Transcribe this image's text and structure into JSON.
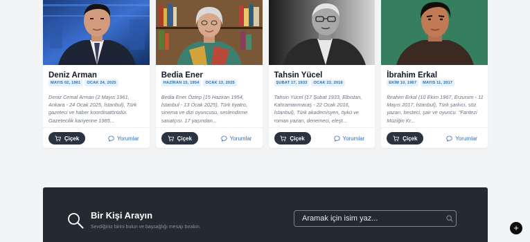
{
  "people": [
    {
      "name": "Deniz Arman",
      "birth": "MAYIS 02, 1961",
      "death": "OCAK 24, 2025",
      "excerpt": "Deniz Cemal Arman (2 Mayıs 1961, Ankara - 24 Ocak 2025, İstanbul), Türk gazeteci ve haber koordinatörüdür. Gazetecilik kariyerine 1985...",
      "flower_label": "Çiçek",
      "comments_label": "Yorumlar"
    },
    {
      "name": "Bedia Ener",
      "birth": "HAZİRAN 15, 1954",
      "death": "OCAK 13, 2025",
      "excerpt": "Bedia Ener Öztep (15 Haziran 1954, İstanbul - 13 Ocak 2025), Türk tiyatro, sinema ve dizi oyuncusu, seslendirme sanatçısı. 17 yaşından...",
      "flower_label": "Çiçek",
      "comments_label": "Yorumlar"
    },
    {
      "name": "Tahsin Yücel",
      "birth": "ŞUBAT 17, 1933",
      "death": "OCAK 22, 2016",
      "excerpt": "Tahsin Yücel (17 Şubat 1933, Elbistan, Kahramanmaraş - 22 Ocak 2016, İstanbul), Türk akademisyen, öykü ve roman yazarı, denemeci, eleşt...",
      "flower_label": "Çiçek",
      "comments_label": "Yorumlar"
    },
    {
      "name": "İbrahim Erkal",
      "birth": "EKİM 10, 1967",
      "death": "MAYIS 11, 2017",
      "excerpt": "İbrahim Erkal (10 Ekim 1967, Erzurum - 11 Mayıs 2017, İstanbul), Türk şarkıcı, söz yazarı, besteci, şair ve oyuncu. \"Fantezi Müziğin Kr...",
      "flower_label": "Çiçek",
      "comments_label": "Yorumlar"
    }
  ],
  "search_panel": {
    "title": "Bir Kişi Arayın",
    "subtitle": "Sevdiğiniz birini bulun ve başsağlığı mesajı bırakın.",
    "input_placeholder": "Aramak için isim yaz...",
    "input_value": ""
  },
  "fab_label": "+",
  "colors": {
    "accent_blue": "#2f6fb5",
    "dark_button": "#2a3340",
    "panel_bg": "#242a32",
    "badge_bg": "#e6f1fb"
  },
  "icons": {
    "flower_button": "cart-icon",
    "comments_button": "chat-bubble-icon",
    "panel": "search-icon",
    "input": "search-icon",
    "fab": "plus-icon"
  }
}
